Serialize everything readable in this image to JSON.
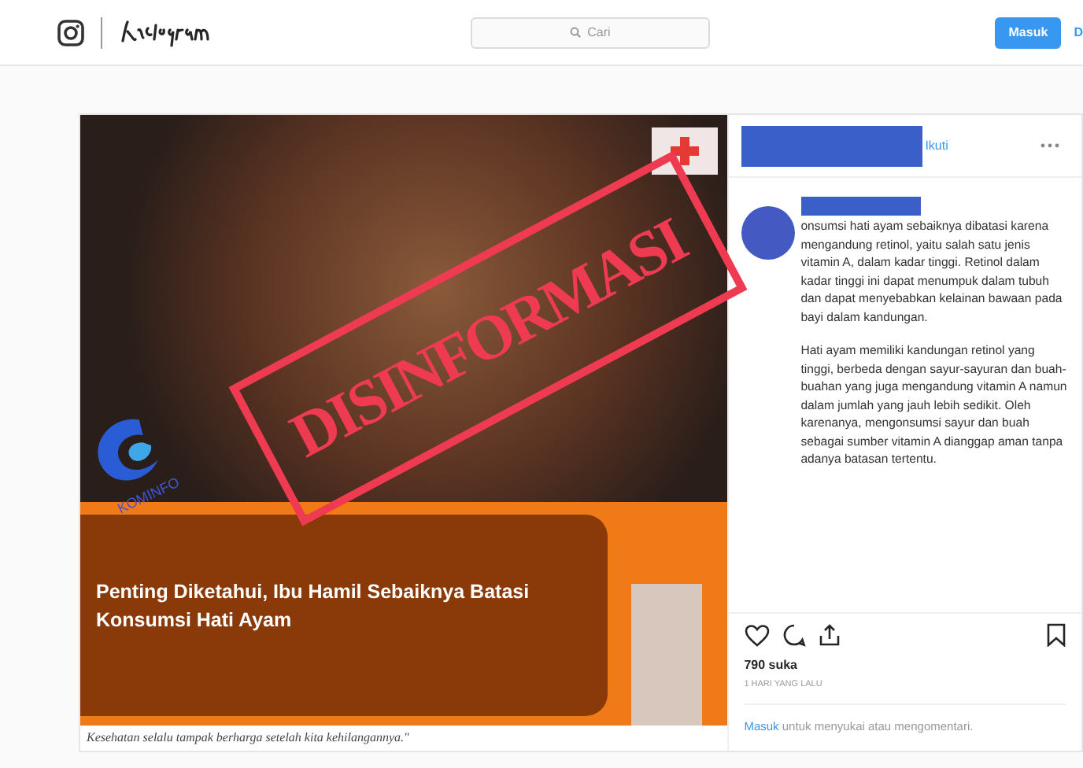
{
  "header": {
    "search_placeholder": "Cari",
    "login_button": "Masuk",
    "signup_button": "D"
  },
  "post": {
    "image": {
      "headline": "Penting Diketahui, Ibu Hamil Sebaiknya Batasi Konsumsi Hati Ayam",
      "caption": "Kesehatan selalu tampak berharga setelah kita kehilangannya.\"",
      "stamp": "DISINFORMASI",
      "logo_text": "KOMINFO"
    },
    "follow_link": "Ikuti",
    "comment_paragraphs": [
      "onsumsi hati ayam sebaiknya dibatasi karena mengandung retinol, yaitu salah satu jenis vitamin A, dalam kadar tinggi. Retinol dalam kadar tinggi ini dapat menumpuk dalam tubuh dan dapat menyebabkan kelainan bawaan pada bayi dalam kandungan.",
      "Hati ayam memiliki kandungan retinol yang tinggi, berbeda dengan sayur-sayuran dan buah-buahan yang juga mengandung vitamin A namun dalam jumlah yang jauh lebih sedikit. Oleh karenanya, mengonsumsi sayur dan buah sebagai sumber vitamin A dianggap aman tanpa adanya batasan tertentu."
    ],
    "likes": "790 suka",
    "time": "1 HARI YANG LALU",
    "login_prompt": {
      "link": "Masuk",
      "text": "untuk menyukai atau mengomentari."
    }
  }
}
